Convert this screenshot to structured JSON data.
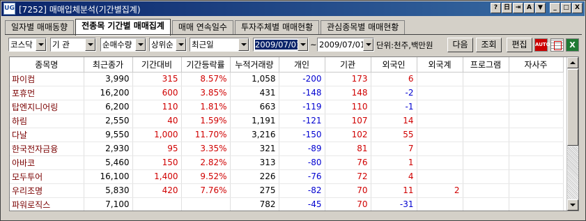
{
  "window": {
    "app_icon": "UG",
    "title": "[7252] 매매입체분석(기간별집계)",
    "title_buttons": [
      "?",
      "日",
      "⇥",
      "A",
      "▼",
      "_",
      "□",
      "X"
    ]
  },
  "tabs": [
    {
      "label": "일자별 매매동향",
      "active": false
    },
    {
      "label": "전종목 기간별 매매집계",
      "active": true
    },
    {
      "label": "매매 연속일수",
      "active": false
    },
    {
      "label": "투자주체별 매매현황",
      "active": false
    },
    {
      "label": "관심종목별 매매현황",
      "active": false
    }
  ],
  "toolbar": {
    "market": "코스닥",
    "investor": "기 관",
    "sort_by": "순매수량",
    "rank": "상위순",
    "period": "최근일",
    "date_from": "2009/07/01",
    "tilde": "~",
    "date_to": "2009/07/01",
    "unit": "단위:천주,백만원",
    "next_label": "다음",
    "query_label": "조회",
    "edit_label": "편집",
    "auto_label": "AUTO",
    "excel_label": "X"
  },
  "table": {
    "columns": [
      "종목명",
      "최근종가",
      "기간대비",
      "기간등락률",
      "누적거래량",
      "개인",
      "기관",
      "외국인",
      "외국계",
      "프로그램",
      "자사주"
    ],
    "rows": [
      {
        "name": "파이컴",
        "close": "3,990",
        "change": "315",
        "rate": "8.57%",
        "volume": "1,058",
        "individual": "-200",
        "institution": "173",
        "foreign": "6",
        "foreign_firm": "",
        "program": "",
        "treasury": ""
      },
      {
        "name": "포휴먼",
        "close": "16,200",
        "change": "600",
        "rate": "3.85%",
        "volume": "431",
        "individual": "-148",
        "institution": "148",
        "foreign": "-2",
        "foreign_firm": "",
        "program": "",
        "treasury": ""
      },
      {
        "name": "탑엔지니어링",
        "close": "6,200",
        "change": "110",
        "rate": "1.81%",
        "volume": "663",
        "individual": "-119",
        "institution": "110",
        "foreign": "-1",
        "foreign_firm": "",
        "program": "",
        "treasury": ""
      },
      {
        "name": "하림",
        "close": "2,550",
        "change": "40",
        "rate": "1.59%",
        "volume": "1,191",
        "individual": "-121",
        "institution": "107",
        "foreign": "14",
        "foreign_firm": "",
        "program": "",
        "treasury": ""
      },
      {
        "name": "다날",
        "close": "9,550",
        "change": "1,000",
        "rate": "11.70%",
        "volume": "3,216",
        "individual": "-150",
        "institution": "102",
        "foreign": "55",
        "foreign_firm": "",
        "program": "",
        "treasury": ""
      },
      {
        "name": "한국전자금융",
        "close": "2,930",
        "change": "95",
        "rate": "3.35%",
        "volume": "321",
        "individual": "-89",
        "institution": "81",
        "foreign": "7",
        "foreign_firm": "",
        "program": "",
        "treasury": ""
      },
      {
        "name": "아바코",
        "close": "5,460",
        "change": "150",
        "rate": "2.82%",
        "volume": "313",
        "individual": "-80",
        "institution": "76",
        "foreign": "1",
        "foreign_firm": "",
        "program": "",
        "treasury": ""
      },
      {
        "name": "모두투어",
        "close": "16,100",
        "change": "1,400",
        "rate": "9.52%",
        "volume": "226",
        "individual": "-76",
        "institution": "72",
        "foreign": "4",
        "foreign_firm": "",
        "program": "",
        "treasury": ""
      },
      {
        "name": "우리조명",
        "close": "5,830",
        "change": "420",
        "rate": "7.76%",
        "volume": "275",
        "individual": "-82",
        "institution": "70",
        "foreign": "11",
        "foreign_firm": "2",
        "program": "",
        "treasury": ""
      },
      {
        "name": "파워로직스",
        "close": "7,100",
        "change": "",
        "rate": "",
        "volume": "782",
        "individual": "-45",
        "institution": "70",
        "foreign": "-31",
        "foreign_firm": "",
        "program": "",
        "treasury": ""
      }
    ]
  },
  "colors": {
    "up": "#d00000",
    "down": "#0000d0",
    "name": "#7a0000",
    "title_bar": "#0a246a"
  }
}
